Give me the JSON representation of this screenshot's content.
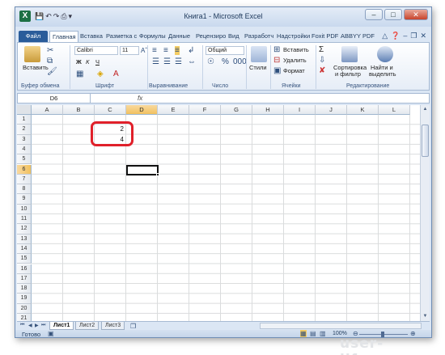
{
  "window": {
    "title": "Книга1 - Microsoft Excel"
  },
  "qat": {
    "icons": [
      "save-icon",
      "undo-icon",
      "redo-icon",
      "print-icon",
      "customize-icon"
    ]
  },
  "tabs": [
    {
      "label": "Файл"
    },
    {
      "label": "Главная"
    },
    {
      "label": "Вставка"
    },
    {
      "label": "Разметка с"
    },
    {
      "label": "Формулы"
    },
    {
      "label": "Данные"
    },
    {
      "label": "Рецензиро"
    },
    {
      "label": "Вид"
    },
    {
      "label": "Разработч"
    },
    {
      "label": "Надстройки"
    },
    {
      "label": "Foxit PDF"
    },
    {
      "label": "ABBYY PDF"
    }
  ],
  "ribbon": {
    "paste_label": "Вставить",
    "font_name": "Calibri",
    "font_size": "11",
    "number_format": "Общий",
    "styles_label": "Стили",
    "insert_label": "Вставить",
    "delete_label": "Удалить",
    "format_label": "Формат",
    "sort_label": "Сортировка",
    "sort_label2": "и фильтр",
    "find_label": "Найти и",
    "find_label2": "выделить",
    "bold": "Ж",
    "italic": "К",
    "underline": "Ч",
    "sigma": "Σ",
    "groups": {
      "clipboard": "Буфер обмена",
      "font": "Шрифт",
      "alignment": "Выравнивание",
      "number": "Число",
      "cells": "Ячейки",
      "editing": "Редактирование"
    }
  },
  "formula_bar": {
    "name_box": "D6",
    "fx": "fx",
    "content": ""
  },
  "sheet": {
    "columns": [
      "A",
      "B",
      "C",
      "D",
      "E",
      "F",
      "G",
      "H",
      "I",
      "J",
      "K",
      "L"
    ],
    "rows": [
      "1",
      "2",
      "3",
      "4",
      "5",
      "6",
      "7",
      "8",
      "9",
      "10",
      "11",
      "12",
      "13",
      "14",
      "15",
      "16",
      "17",
      "18",
      "19",
      "20",
      "21"
    ],
    "selected_cell": "D6",
    "cell_values": [
      {
        "ref": "C2",
        "value": "2"
      },
      {
        "ref": "C3",
        "value": "4"
      }
    ]
  },
  "sheet_tabs": [
    {
      "label": "Лист1"
    },
    {
      "label": "Лист2"
    },
    {
      "label": "Лист3"
    }
  ],
  "status": {
    "ready": "Готово",
    "zoom": "100%"
  },
  "watermark": "user-life.com"
}
